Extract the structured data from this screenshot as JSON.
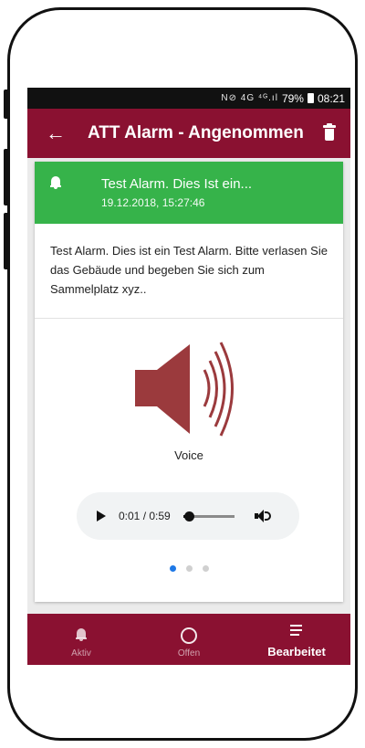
{
  "status_bar": {
    "icons": "N⊘ 4G ⁴ᴳ.ıl",
    "battery": "79%",
    "time": "08:21"
  },
  "app_bar": {
    "title": "ATT Alarm - Angenommen",
    "back_icon": "arrow-left-icon",
    "delete_icon": "trash-icon"
  },
  "alarm": {
    "title": "Test Alarm. Dies Ist ein...",
    "datetime": "19.12.2018, 15:27:46",
    "message": "Test Alarm. Dies ist ein Test Alarm. Bitte verlasen Sie das Gebäude und begeben Sie sich zum Sammelplatz xyz..",
    "header_color": "#36b34a",
    "media_label": "Voice",
    "speaker_color": "#9b3a3d"
  },
  "player": {
    "time": "0:01 / 0:59",
    "progress_fraction": 0.017
  },
  "pager": {
    "count": 3,
    "active_index": 0
  },
  "bottom_nav": {
    "items": [
      {
        "label": "Aktiv",
        "icon": "bell-icon"
      },
      {
        "label": "Offen",
        "icon": "circle-icon"
      },
      {
        "label": "Bearbeitet",
        "icon": "list-icon"
      }
    ],
    "active_index": 2
  },
  "colors": {
    "brand": "#8a1131",
    "pager_active": "#1e78e6"
  }
}
